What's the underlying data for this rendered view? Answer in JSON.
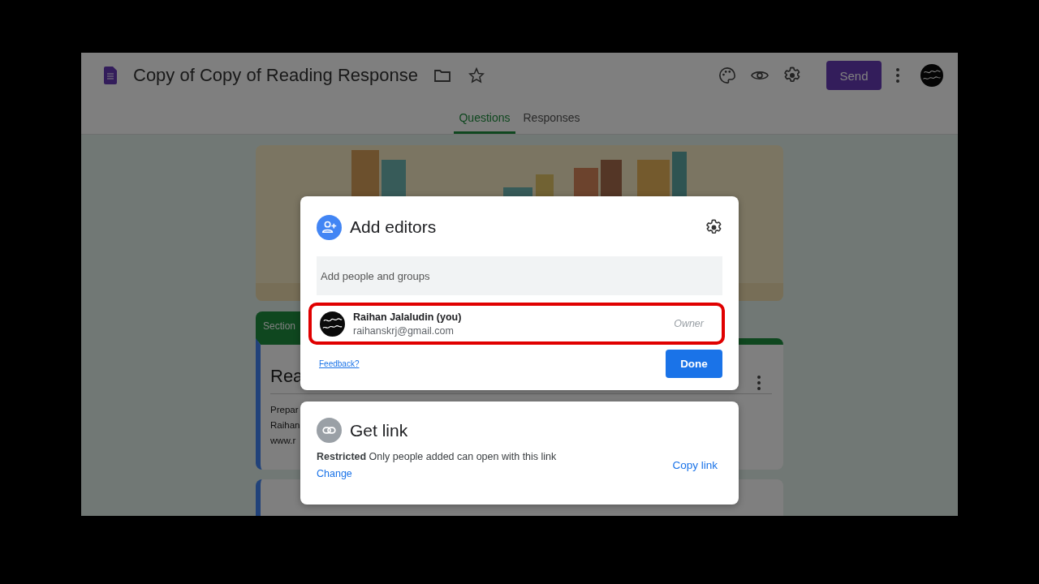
{
  "app_bar": {
    "title": "Copy of Copy of Reading Response",
    "send_button": "Send"
  },
  "tabs": [
    {
      "label": "Questions",
      "selected": true
    },
    {
      "label": "Responses",
      "selected": false
    }
  ],
  "form_behind": {
    "section_label": "Section",
    "title": "Rea",
    "description_lines": [
      "Prepar",
      "Raihan",
      "www.r"
    ]
  },
  "share_dialog": {
    "title": "Add editors",
    "placeholder": "Add people and groups",
    "people": [
      {
        "name": "Raihan Jalaludin (you)",
        "email": "raihanskrj@gmail.com",
        "role": "Owner",
        "highlighted": true
      }
    ],
    "feedback_link": "Feedback?",
    "done_button": "Done"
  },
  "link_dialog": {
    "title": "Get link",
    "access_text": "**Restricted** Only people added can open with this link",
    "change_link": "Change",
    "copy_link": "Copy link"
  }
}
